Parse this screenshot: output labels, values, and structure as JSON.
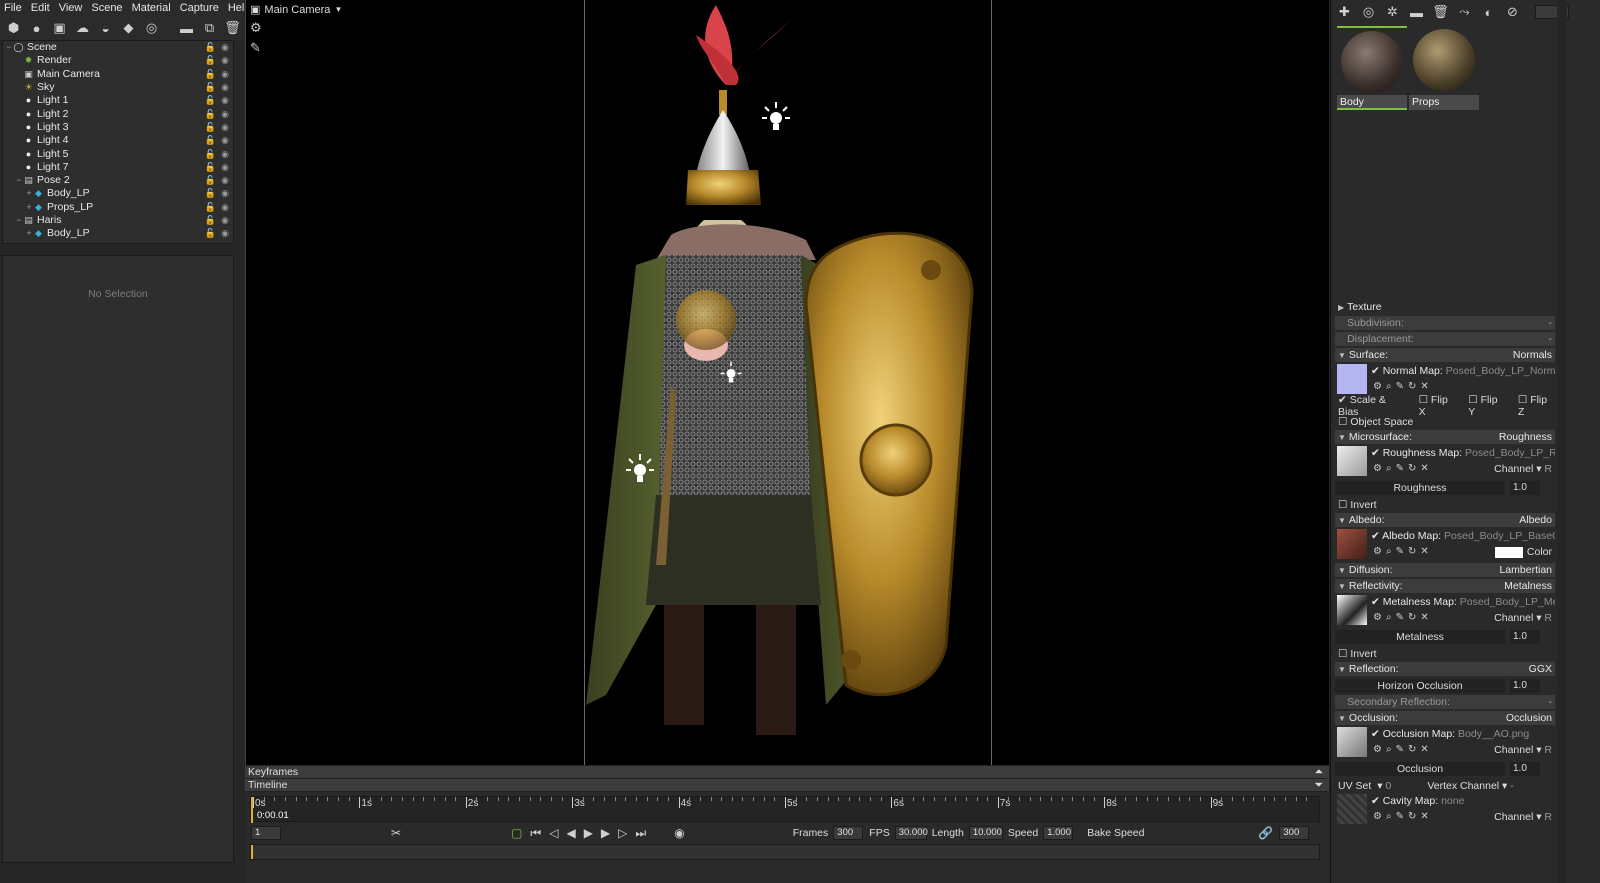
{
  "menu": [
    "File",
    "Edit",
    "View",
    "Scene",
    "Material",
    "Capture",
    "Help"
  ],
  "scene_toolbar_icons": [
    "mesh-icon",
    "light-icon",
    "camera-icon",
    "sky-icon",
    "cloth-icon",
    "group-icon",
    "turntable-icon",
    "folder-icon",
    "duplicate-icon",
    "delete-icon"
  ],
  "tree": [
    {
      "label": "Scene",
      "indent": 0,
      "exp": "−",
      "icon": "globe-icon"
    },
    {
      "label": "Render",
      "indent": 1,
      "exp": "",
      "icon": "render-icon"
    },
    {
      "label": "Main Camera",
      "indent": 1,
      "exp": "",
      "icon": "camera-icon"
    },
    {
      "label": "Sky",
      "indent": 1,
      "exp": "",
      "icon": "sky-icon"
    },
    {
      "label": "Light 1",
      "indent": 1,
      "exp": "",
      "icon": "bulb-icon"
    },
    {
      "label": "Light 2",
      "indent": 1,
      "exp": "",
      "icon": "bulb-icon"
    },
    {
      "label": "Light 3",
      "indent": 1,
      "exp": "",
      "icon": "bulb-icon"
    },
    {
      "label": "Light 4",
      "indent": 1,
      "exp": "",
      "icon": "bulb-icon"
    },
    {
      "label": "Light 5",
      "indent": 1,
      "exp": "",
      "icon": "bulb-icon"
    },
    {
      "label": "Light 7",
      "indent": 1,
      "exp": "",
      "icon": "bulb-icon"
    },
    {
      "label": "Pose 2",
      "indent": 1,
      "exp": "−",
      "icon": "model-icon"
    },
    {
      "label": "Body_LP",
      "indent": 2,
      "exp": "+",
      "icon": "cube-icon"
    },
    {
      "label": "Props_LP",
      "indent": 2,
      "exp": "+",
      "icon": "cube-icon"
    },
    {
      "label": "Haris",
      "indent": 1,
      "exp": "−",
      "icon": "model-icon"
    },
    {
      "label": "Body_LP",
      "indent": 2,
      "exp": "+",
      "icon": "cube-icon"
    }
  ],
  "no_selection": "No Selection",
  "viewport": {
    "camera": "Main Camera"
  },
  "timeline": {
    "keyframes_label": "Keyframes",
    "timeline_label": "Timeline",
    "ticks": [
      "0s",
      "1s",
      "2s",
      "3s",
      "4s",
      "5s",
      "6s",
      "7s",
      "8s",
      "9s"
    ],
    "current_time": "0:00.01",
    "frame": "1",
    "frames_label": "Frames",
    "frames": "300",
    "fps_label": "FPS",
    "fps": "30.000",
    "length_label": "Length",
    "length": "10.000",
    "speed_label": "Speed",
    "speed": "1.000",
    "bake_speed": "Bake Speed",
    "end_frame": "300"
  },
  "material": {
    "nav": "- /",
    "thumbs": [
      {
        "label": "Body",
        "selected": true
      },
      {
        "label": "Props",
        "selected": false
      }
    ],
    "texture": "Texture",
    "subdivision": {
      "label": "Subdivision:",
      "value": "-"
    },
    "displacement": {
      "label": "Displacement:",
      "value": "-"
    },
    "surface": {
      "label": "Surface:",
      "value": "Normals"
    },
    "normal_map": {
      "label": "Normal Map:",
      "file": "Posed_Body_LP_Normal.png"
    },
    "scale_bias": "Scale & Bias",
    "flip_x": "Flip X",
    "flip_y": "Flip Y",
    "flip_z": "Flip Z",
    "object_space": "Object Space",
    "microsurface": {
      "label": "Microsurface:",
      "value": "Roughness"
    },
    "roughness_map": {
      "label": "Roughness Map:",
      "file": "Posed_Body_LP_Roughness.png"
    },
    "channel_label": "Channel",
    "channel_r": "R",
    "roughness": {
      "label": "Roughness",
      "value": "1.0"
    },
    "invert": "Invert",
    "albedo": {
      "label": "Albedo:",
      "value": "Albedo"
    },
    "albedo_map": {
      "label": "Albedo Map:",
      "file": "Posed_Body_LP_BaseColor.png"
    },
    "color": "Color",
    "diffusion": {
      "label": "Diffusion:",
      "value": "Lambertian"
    },
    "reflectivity": {
      "label": "Reflectivity:",
      "value": "Metalness"
    },
    "metalness_map": {
      "label": "Metalness Map:",
      "file": "Posed_Body_LP_Metallic.png"
    },
    "metalness": {
      "label": "Metalness",
      "value": "1.0"
    },
    "reflection": {
      "label": "Reflection:",
      "value": "GGX"
    },
    "horizon": {
      "label": "Horizon Occlusion",
      "value": "1.0"
    },
    "secondary": {
      "label": "Secondary Reflection:",
      "value": "-"
    },
    "occlusion": {
      "label": "Occlusion:",
      "value": "Occlusion"
    },
    "occlusion_map": {
      "label": "Occlusion Map:",
      "file": "Body__AO.png"
    },
    "occlusion_slider": {
      "label": "Occlusion",
      "value": "1.0"
    },
    "uv_set": "UV Set",
    "uv_set_value": "0",
    "vertex_channel": "Vertex Channel",
    "vertex_channel_value": "-",
    "cavity_map": {
      "label": "Cavity Map:",
      "file": "none"
    }
  },
  "colors": {
    "accent": "#e4b02a",
    "selected": "#7fbf3f",
    "background": "#2a2a2a"
  }
}
